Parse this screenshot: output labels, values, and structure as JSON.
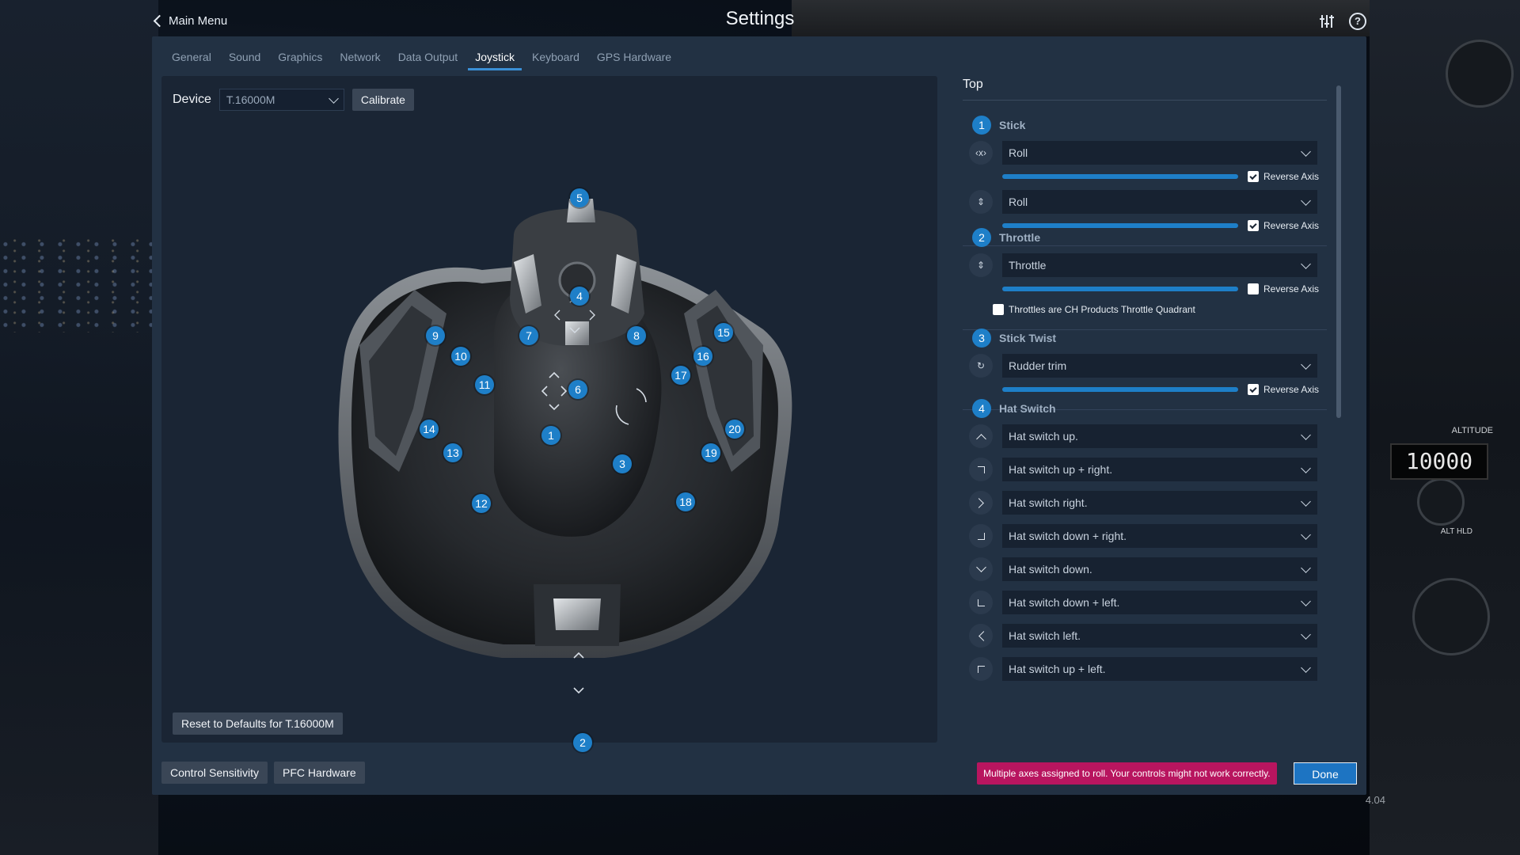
{
  "header": {
    "back_label": "Main Menu",
    "title": "Settings",
    "icons": [
      "sliders-icon",
      "help-icon"
    ],
    "help_glyph": "?"
  },
  "background": {
    "altitude_label": "ALTITUDE",
    "altitude_value": "10000",
    "alt_hld": "ALT HLD",
    "version": "4.04"
  },
  "tabs": [
    {
      "label": "General",
      "active": false
    },
    {
      "label": "Sound",
      "active": false
    },
    {
      "label": "Graphics",
      "active": false
    },
    {
      "label": "Network",
      "active": false
    },
    {
      "label": "Data Output",
      "active": false
    },
    {
      "label": "Joystick",
      "active": true
    },
    {
      "label": "Keyboard",
      "active": false
    },
    {
      "label": "GPS Hardware",
      "active": false
    }
  ],
  "device": {
    "label": "Device",
    "selected": "T.16000M",
    "calibrate_label": "Calibrate",
    "reset_label": "Reset to Defaults for T.16000M"
  },
  "markers": [
    "1",
    "2",
    "3",
    "4",
    "5",
    "6",
    "7",
    "8",
    "9",
    "10",
    "11",
    "12",
    "13",
    "14",
    "15",
    "16",
    "17",
    "18",
    "19",
    "20"
  ],
  "panel": {
    "section_title": "Top",
    "groups": [
      {
        "num": "1",
        "name": "Stick",
        "axes": [
          {
            "icon": "horizontal-axis-icon",
            "assignment": "Roll",
            "reverse_label": "Reverse Axis",
            "reversed": true,
            "level": 1.0
          },
          {
            "icon": "vertical-axis-icon",
            "assignment": "Roll",
            "reverse_label": "Reverse Axis",
            "reversed": true,
            "level": 1.0
          }
        ]
      },
      {
        "num": "2",
        "name": "Throttle",
        "axes": [
          {
            "icon": "vertical-axis-icon",
            "assignment": "Throttle",
            "reverse_label": "Reverse Axis",
            "reversed": false,
            "level": 1.0
          }
        ],
        "extra_check_label": "Throttles are CH Products Throttle Quadrant",
        "extra_checked": false
      },
      {
        "num": "3",
        "name": "Stick Twist",
        "axes": [
          {
            "icon": "twist-axis-icon",
            "assignment": "Rudder trim",
            "reverse_label": "Reverse Axis",
            "reversed": true,
            "level": 1.0
          }
        ]
      },
      {
        "num": "4",
        "name": "Hat Switch",
        "hats": [
          {
            "icon": "hat-up-icon",
            "assignment": "Hat switch up."
          },
          {
            "icon": "hat-up-right-icon",
            "assignment": "Hat switch up + right."
          },
          {
            "icon": "hat-right-icon",
            "assignment": "Hat switch right."
          },
          {
            "icon": "hat-down-right-icon",
            "assignment": "Hat switch down + right."
          },
          {
            "icon": "hat-down-icon",
            "assignment": "Hat switch down."
          },
          {
            "icon": "hat-down-left-icon",
            "assignment": "Hat switch down + left."
          },
          {
            "icon": "hat-left-icon",
            "assignment": "Hat switch left."
          },
          {
            "icon": "hat-up-left-icon",
            "assignment": "Hat switch up + left."
          }
        ]
      }
    ]
  },
  "bottom": {
    "control_sensitivity_label": "Control Sensitivity",
    "pfc_label": "PFC Hardware",
    "warning": "Multiple axes assigned to roll. Your controls might not work correctly.",
    "done_label": "Done"
  },
  "colors": {
    "accent": "#1e7fc8",
    "warning_bg": "#b8155f",
    "window_bg": "#223143"
  }
}
